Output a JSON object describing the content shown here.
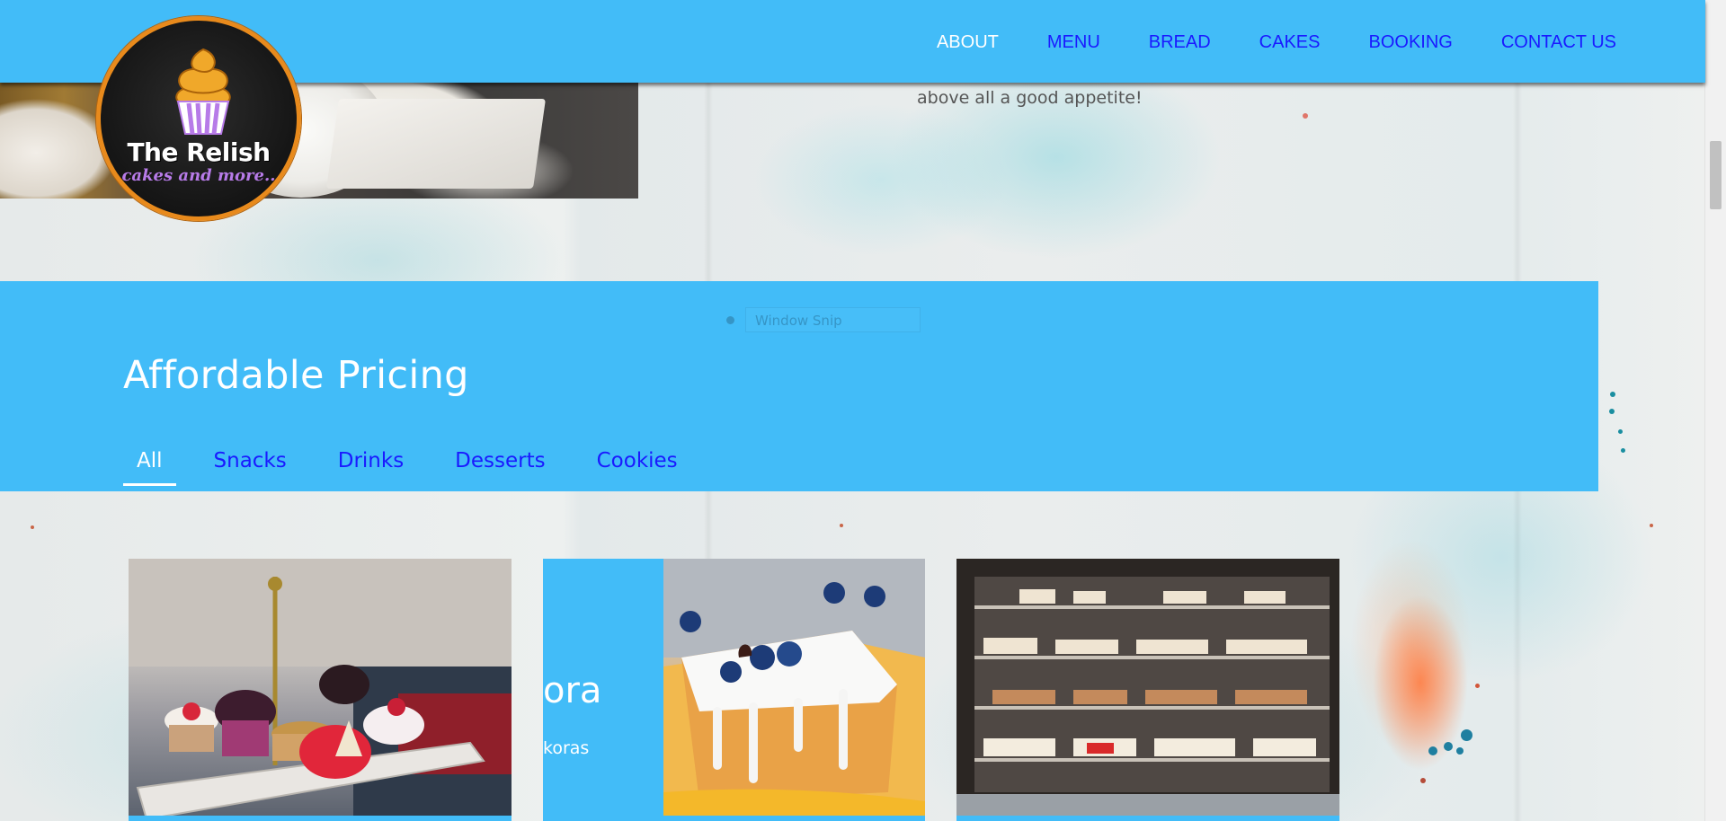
{
  "intro": {
    "text_fragment": "above all a good appetite!"
  },
  "navbar": {
    "links": [
      {
        "label": "ABOUT",
        "active": true
      },
      {
        "label": "MENU",
        "active": false
      },
      {
        "label": "BREAD",
        "active": false
      },
      {
        "label": "CAKES",
        "active": false
      },
      {
        "label": "BOOKING",
        "active": false
      },
      {
        "label": "CONTACT US",
        "active": false
      }
    ]
  },
  "logo": {
    "title": "The Relish",
    "subtitle": "cakes and more..",
    "icon": "cupcake-icon"
  },
  "overlay": {
    "window_snip_label": "Window Snip"
  },
  "pricing": {
    "title": "Affordable Pricing",
    "filters": [
      "All",
      "Snacks",
      "Drinks",
      "Desserts",
      "Cookies"
    ],
    "active_filter": "All"
  },
  "cards": [
    {
      "image": "cupcakes-tray-photo"
    },
    {
      "image": "blueberry-cake-photo",
      "overlay_title_fragment": "ora",
      "overlay_sub_fragment": "koras"
    },
    {
      "image": "bakery-display-case-photo"
    }
  ],
  "colors": {
    "brand_blue": "#42bcf8",
    "link_blue": "#1a1aff",
    "active_white": "#ffffff",
    "logo_orange": "#e88a1c",
    "logo_purple": "#b77be8"
  }
}
